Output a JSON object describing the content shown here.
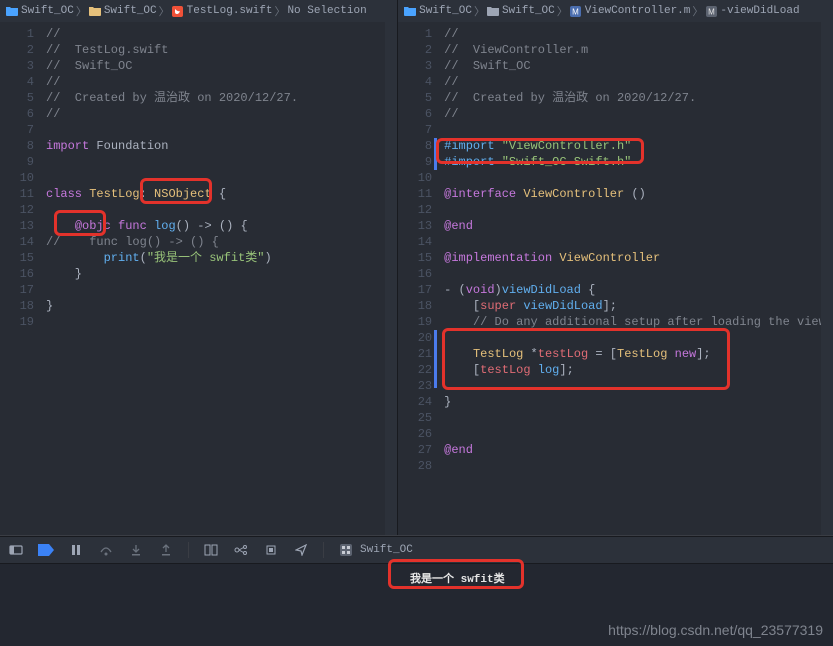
{
  "left": {
    "breadcrumb": [
      {
        "icon": "folder-blue",
        "label": "Swift_OC"
      },
      {
        "icon": "folder-yellow",
        "label": "Swift_OC"
      },
      {
        "icon": "swift",
        "label": "TestLog.swift"
      },
      {
        "icon": "",
        "label": "No Selection"
      }
    ],
    "lines": [
      {
        "n": 1,
        "segs": [
          {
            "cls": "c-comment",
            "t": "//"
          }
        ]
      },
      {
        "n": 2,
        "segs": [
          {
            "cls": "c-comment",
            "t": "//  TestLog.swift"
          }
        ]
      },
      {
        "n": 3,
        "segs": [
          {
            "cls": "c-comment",
            "t": "//  Swift_OC"
          }
        ]
      },
      {
        "n": 4,
        "segs": [
          {
            "cls": "c-comment",
            "t": "//"
          }
        ]
      },
      {
        "n": 5,
        "segs": [
          {
            "cls": "c-comment",
            "t": "//  Created by 温治政 on 2020/12/27."
          }
        ]
      },
      {
        "n": 6,
        "segs": [
          {
            "cls": "c-comment",
            "t": "//"
          }
        ]
      },
      {
        "n": 7,
        "segs": [
          {
            "cls": "c-plain",
            "t": ""
          }
        ]
      },
      {
        "n": 8,
        "segs": [
          {
            "cls": "c-keyword",
            "t": "import"
          },
          {
            "cls": "c-plain",
            "t": " Foundation"
          }
        ]
      },
      {
        "n": 9,
        "segs": [
          {
            "cls": "c-plain",
            "t": ""
          }
        ]
      },
      {
        "n": 10,
        "segs": [
          {
            "cls": "c-plain",
            "t": ""
          }
        ]
      },
      {
        "n": 11,
        "segs": [
          {
            "cls": "c-keyword",
            "t": "class"
          },
          {
            "cls": "c-plain",
            "t": " "
          },
          {
            "cls": "c-ident",
            "t": "TestLog"
          },
          {
            "cls": "c-plain",
            "t": ": "
          },
          {
            "cls": "c-type",
            "t": "NSObject"
          },
          {
            "cls": "c-plain",
            "t": " {"
          }
        ]
      },
      {
        "n": 12,
        "segs": [
          {
            "cls": "c-plain",
            "t": ""
          }
        ]
      },
      {
        "n": 13,
        "segs": [
          {
            "cls": "c-plain",
            "t": "    "
          },
          {
            "cls": "c-keyword",
            "t": "@objc"
          },
          {
            "cls": "c-plain",
            "t": " "
          },
          {
            "cls": "c-keyword",
            "t": "func"
          },
          {
            "cls": "c-plain",
            "t": " "
          },
          {
            "cls": "c-func",
            "t": "log"
          },
          {
            "cls": "c-plain",
            "t": "() -> () {"
          }
        ]
      },
      {
        "n": 14,
        "segs": [
          {
            "cls": "c-comment",
            "t": "//    func log() -> () {"
          }
        ]
      },
      {
        "n": 15,
        "segs": [
          {
            "cls": "c-plain",
            "t": "        "
          },
          {
            "cls": "c-func",
            "t": "print"
          },
          {
            "cls": "c-plain",
            "t": "("
          },
          {
            "cls": "c-string",
            "t": "\"我是一个 swfit类\""
          },
          {
            "cls": "c-plain",
            "t": ")"
          }
        ]
      },
      {
        "n": 16,
        "segs": [
          {
            "cls": "c-plain",
            "t": "    }"
          }
        ]
      },
      {
        "n": 17,
        "segs": [
          {
            "cls": "c-plain",
            "t": ""
          }
        ]
      },
      {
        "n": 18,
        "segs": [
          {
            "cls": "c-plain",
            "t": "}"
          }
        ]
      },
      {
        "n": 19,
        "segs": [
          {
            "cls": "c-plain",
            "t": ""
          }
        ]
      }
    ]
  },
  "right": {
    "breadcrumb": [
      {
        "icon": "folder-blue",
        "label": "Swift_OC"
      },
      {
        "icon": "folder-gray",
        "label": "Swift_OC"
      },
      {
        "icon": "objc",
        "label": "ViewController.m"
      },
      {
        "icon": "method",
        "label": "-viewDidLoad"
      }
    ],
    "lines": [
      {
        "n": 1,
        "segs": [
          {
            "cls": "c-comment",
            "t": "//"
          }
        ]
      },
      {
        "n": 2,
        "segs": [
          {
            "cls": "c-comment",
            "t": "//  ViewController.m"
          }
        ]
      },
      {
        "n": 3,
        "segs": [
          {
            "cls": "c-comment",
            "t": "//  Swift_OC"
          }
        ]
      },
      {
        "n": 4,
        "segs": [
          {
            "cls": "c-comment",
            "t": "//"
          }
        ]
      },
      {
        "n": 5,
        "segs": [
          {
            "cls": "c-comment",
            "t": "//  Created by 温治政 on 2020/12/27."
          }
        ]
      },
      {
        "n": 6,
        "segs": [
          {
            "cls": "c-comment",
            "t": "//"
          }
        ]
      },
      {
        "n": 7,
        "segs": [
          {
            "cls": "c-plain",
            "t": ""
          }
        ]
      },
      {
        "n": 8,
        "segs": [
          {
            "cls": "c-preimp",
            "t": "#import "
          },
          {
            "cls": "c-string",
            "t": "\"ViewController.h\""
          }
        ]
      },
      {
        "n": 9,
        "segs": [
          {
            "cls": "c-preimp",
            "t": "#import "
          },
          {
            "cls": "c-string",
            "t": "\"Swift_OC-Swift.h\""
          }
        ]
      },
      {
        "n": 10,
        "segs": [
          {
            "cls": "c-plain",
            "t": ""
          }
        ]
      },
      {
        "n": 11,
        "segs": [
          {
            "cls": "c-objckw",
            "t": "@interface"
          },
          {
            "cls": "c-plain",
            "t": " "
          },
          {
            "cls": "c-type",
            "t": "ViewController"
          },
          {
            "cls": "c-plain",
            "t": " ()"
          }
        ]
      },
      {
        "n": 12,
        "segs": [
          {
            "cls": "c-plain",
            "t": ""
          }
        ]
      },
      {
        "n": 13,
        "segs": [
          {
            "cls": "c-objckw",
            "t": "@end"
          }
        ]
      },
      {
        "n": 14,
        "segs": [
          {
            "cls": "c-plain",
            "t": ""
          }
        ]
      },
      {
        "n": 15,
        "segs": [
          {
            "cls": "c-objckw",
            "t": "@implementation"
          },
          {
            "cls": "c-plain",
            "t": " "
          },
          {
            "cls": "c-type",
            "t": "ViewController"
          }
        ]
      },
      {
        "n": 16,
        "segs": [
          {
            "cls": "c-plain",
            "t": ""
          }
        ]
      },
      {
        "n": 17,
        "segs": [
          {
            "cls": "c-plain",
            "t": "- ("
          },
          {
            "cls": "c-keyword",
            "t": "void"
          },
          {
            "cls": "c-plain",
            "t": ")"
          },
          {
            "cls": "c-method",
            "t": "viewDidLoad"
          },
          {
            "cls": "c-plain",
            "t": " {"
          }
        ]
      },
      {
        "n": 18,
        "segs": [
          {
            "cls": "c-plain",
            "t": "    ["
          },
          {
            "cls": "c-super",
            "t": "super"
          },
          {
            "cls": "c-plain",
            "t": " "
          },
          {
            "cls": "c-method",
            "t": "viewDidLoad"
          },
          {
            "cls": "c-plain",
            "t": "];"
          }
        ]
      },
      {
        "n": 19,
        "segs": [
          {
            "cls": "c-plain",
            "t": "    "
          },
          {
            "cls": "c-comment",
            "t": "// Do any additional setup after loading the view."
          }
        ]
      },
      {
        "n": 20,
        "segs": [
          {
            "cls": "c-plain",
            "t": "    "
          }
        ]
      },
      {
        "n": 21,
        "segs": [
          {
            "cls": "c-plain",
            "t": "    "
          },
          {
            "cls": "c-type",
            "t": "TestLog"
          },
          {
            "cls": "c-plain",
            "t": " *"
          },
          {
            "cls": "c-var",
            "t": "testLog"
          },
          {
            "cls": "c-plain",
            "t": " = ["
          },
          {
            "cls": "c-type",
            "t": "TestLog"
          },
          {
            "cls": "c-plain",
            "t": " "
          },
          {
            "cls": "c-new",
            "t": "new"
          },
          {
            "cls": "c-plain",
            "t": "];"
          }
        ]
      },
      {
        "n": 22,
        "segs": [
          {
            "cls": "c-plain",
            "t": "    ["
          },
          {
            "cls": "c-var",
            "t": "testLog"
          },
          {
            "cls": "c-plain",
            "t": " "
          },
          {
            "cls": "c-method",
            "t": "log"
          },
          {
            "cls": "c-plain",
            "t": "];"
          }
        ]
      },
      {
        "n": 23,
        "segs": [
          {
            "cls": "c-plain",
            "t": "    "
          }
        ]
      },
      {
        "n": 24,
        "segs": [
          {
            "cls": "c-plain",
            "t": "}"
          }
        ]
      },
      {
        "n": 25,
        "segs": [
          {
            "cls": "c-plain",
            "t": ""
          }
        ]
      },
      {
        "n": 26,
        "segs": [
          {
            "cls": "c-plain",
            "t": ""
          }
        ]
      },
      {
        "n": 27,
        "segs": [
          {
            "cls": "c-objckw",
            "t": "@end"
          }
        ]
      },
      {
        "n": 28,
        "segs": [
          {
            "cls": "c-plain",
            "t": ""
          }
        ]
      }
    ]
  },
  "toolbar": {
    "target": "Swift_OC"
  },
  "console": {
    "output": "我是一个 swfit类"
  },
  "watermark": "https://blog.csdn.net/qq_23577319"
}
